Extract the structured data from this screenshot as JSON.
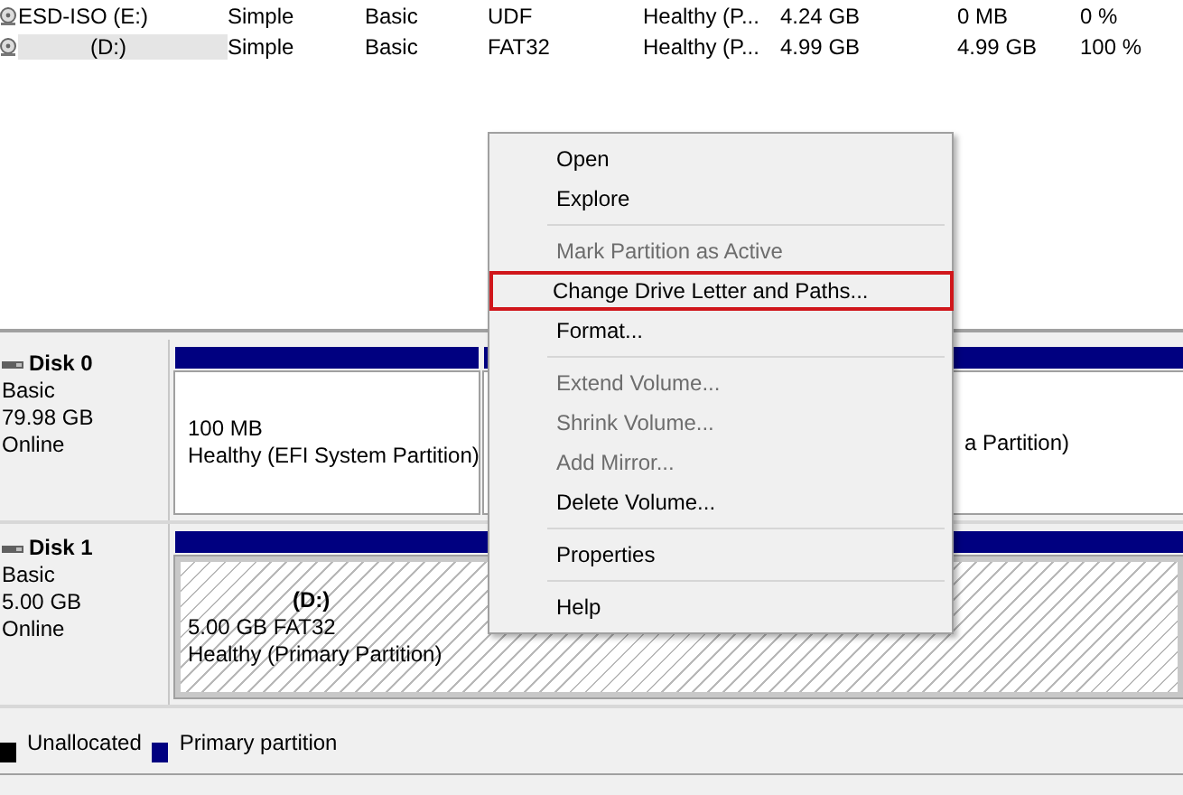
{
  "volumes": [
    {
      "name": "ESD-ISO (E:)",
      "layout": "Simple",
      "type": "Basic",
      "file_system": "UDF",
      "status": "Healthy (P...",
      "capacity": "4.24 GB",
      "free_space": "0 MB",
      "percent_free": "0 %",
      "selected": false
    },
    {
      "name": "(D:)",
      "layout": "Simple",
      "type": "Basic",
      "file_system": "FAT32",
      "status": "Healthy (P...",
      "capacity": "4.99 GB",
      "free_space": "4.99 GB",
      "percent_free": "100 %",
      "selected": true
    }
  ],
  "disks": [
    {
      "name": "Disk 0",
      "type": "Basic",
      "size": "79.98 GB",
      "state": "Online",
      "partitions": [
        {
          "kind": "primary",
          "lines": [
            "100 MB",
            "Healthy (EFI System Partition)"
          ],
          "hatched": false
        },
        {
          "kind": "primary",
          "lines": [
            "a Partition)"
          ],
          "hatched": false,
          "covered": true
        }
      ]
    },
    {
      "name": "Disk 1",
      "type": "Basic",
      "size": "5.00 GB",
      "state": "Online",
      "partitions": [
        {
          "kind": "primary",
          "title": "(D:)",
          "lines": [
            "5.00 GB FAT32",
            "Healthy (Primary Partition)"
          ],
          "hatched": true
        }
      ]
    }
  ],
  "legend": [
    {
      "label": "Unallocated",
      "color": "#000000"
    },
    {
      "label": "Primary partition",
      "color": "#000080"
    }
  ],
  "context_menu": [
    {
      "kind": "item",
      "label": "Open",
      "disabled": false,
      "highlighted": false
    },
    {
      "kind": "item",
      "label": "Explore",
      "disabled": false,
      "highlighted": false
    },
    {
      "kind": "separator"
    },
    {
      "kind": "item",
      "label": "Mark Partition as Active",
      "disabled": true,
      "highlighted": false
    },
    {
      "kind": "item",
      "label": "Change Drive Letter and Paths...",
      "disabled": false,
      "highlighted": true
    },
    {
      "kind": "item",
      "label": "Format...",
      "disabled": false,
      "highlighted": false
    },
    {
      "kind": "separator"
    },
    {
      "kind": "item",
      "label": "Extend Volume...",
      "disabled": true,
      "highlighted": false
    },
    {
      "kind": "item",
      "label": "Shrink Volume...",
      "disabled": true,
      "highlighted": false
    },
    {
      "kind": "item",
      "label": "Add Mirror...",
      "disabled": true,
      "highlighted": false
    },
    {
      "kind": "item",
      "label": "Delete Volume...",
      "disabled": false,
      "highlighted": false
    },
    {
      "kind": "separator"
    },
    {
      "kind": "item",
      "label": "Properties",
      "disabled": false,
      "highlighted": false
    },
    {
      "kind": "separator"
    },
    {
      "kind": "item",
      "label": "Help",
      "disabled": false,
      "highlighted": false
    }
  ]
}
